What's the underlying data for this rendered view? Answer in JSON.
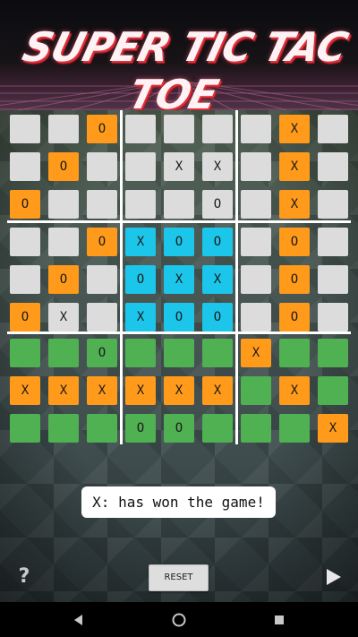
{
  "header": {
    "title": "SUPER TIC TAC TOE"
  },
  "board": {
    "rows": [
      [
        "",
        "",
        "O",
        "",
        "",
        "",
        "",
        "X",
        ""
      ],
      [
        "",
        "O",
        "",
        "",
        "X",
        "X",
        "",
        "X",
        ""
      ],
      [
        "O",
        "",
        "",
        "",
        "",
        "O",
        "",
        "X",
        ""
      ],
      [
        "",
        "",
        "O",
        "X",
        "O",
        "O",
        "",
        "O",
        ""
      ],
      [
        "",
        "O",
        "",
        "O",
        "X",
        "X",
        "",
        "O",
        ""
      ],
      [
        "O",
        "X",
        "",
        "X",
        "O",
        "O",
        "",
        "O",
        ""
      ],
      [
        "",
        "",
        "O",
        "",
        "",
        "",
        "X",
        "",
        ""
      ],
      [
        "X",
        "X",
        "X",
        "X",
        "X",
        "X",
        "",
        "X",
        ""
      ],
      [
        "",
        "",
        "",
        "O",
        "O",
        "",
        "",
        "",
        "X"
      ]
    ],
    "cell_colors": [
      [
        "grey",
        "grey",
        "orange",
        "grey",
        "grey",
        "grey",
        "grey",
        "orange",
        "grey"
      ],
      [
        "grey",
        "orange",
        "grey",
        "grey",
        "grey",
        "grey",
        "grey",
        "orange",
        "grey"
      ],
      [
        "orange",
        "grey",
        "grey",
        "grey",
        "grey",
        "grey",
        "grey",
        "orange",
        "grey"
      ],
      [
        "grey",
        "grey",
        "orange",
        "blue",
        "blue",
        "blue",
        "grey",
        "orange",
        "grey"
      ],
      [
        "grey",
        "orange",
        "grey",
        "blue",
        "blue",
        "blue",
        "grey",
        "orange",
        "grey"
      ],
      [
        "orange",
        "grey",
        "grey",
        "blue",
        "blue",
        "blue",
        "grey",
        "orange",
        "grey"
      ],
      [
        "green",
        "green",
        "green",
        "green",
        "green",
        "green",
        "orange",
        "green",
        "green"
      ],
      [
        "orange",
        "orange",
        "orange",
        "orange",
        "orange",
        "orange",
        "green",
        "orange",
        "green"
      ],
      [
        "green",
        "green",
        "green",
        "green",
        "green",
        "green",
        "green",
        "green",
        "orange"
      ]
    ]
  },
  "status": {
    "message": "X: has won the game!"
  },
  "controls": {
    "help_label": "?",
    "reset_label": "RESET",
    "next_icon": "play-icon"
  },
  "navbar": {
    "back_icon": "back-icon",
    "home_icon": "home-icon",
    "recents_icon": "recents-icon"
  },
  "colors": {
    "grey": "#dcdcdc",
    "orange": "#ff9a1a",
    "blue": "#1cc6ea",
    "green": "#4fb152"
  }
}
